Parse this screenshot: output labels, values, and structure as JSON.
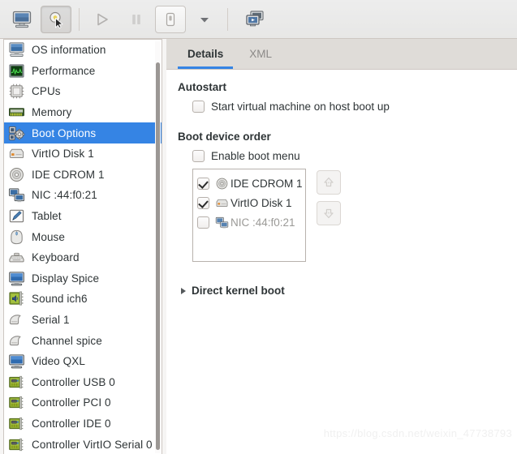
{
  "toolbar": {
    "buttons": [
      {
        "name": "console-view-button",
        "icon": "monitor-icon",
        "active": false
      },
      {
        "name": "details-view-button",
        "icon": "lightbulb-cursor-icon",
        "active": true
      },
      {
        "name": "run-button",
        "icon": "play-icon",
        "active": false
      },
      {
        "name": "pause-button",
        "icon": "pause-icon",
        "active": false
      },
      {
        "name": "shutdown-button",
        "icon": "power-icon",
        "active": false
      },
      {
        "name": "shutdown-menu-button",
        "icon": "chevron-down-icon",
        "active": false
      },
      {
        "name": "snapshots-button",
        "icon": "screens-icon",
        "active": false
      }
    ]
  },
  "sidebar": {
    "items": [
      {
        "label": "OS information",
        "icon": "computer-icon",
        "selected": false
      },
      {
        "label": "Performance",
        "icon": "performance-graph-icon",
        "selected": false
      },
      {
        "label": "CPUs",
        "icon": "cpu-chip-icon",
        "selected": false
      },
      {
        "label": "Memory",
        "icon": "memory-ram-icon",
        "selected": false
      },
      {
        "label": "Boot Options",
        "icon": "boot-options-icon",
        "selected": true
      },
      {
        "label": "VirtIO Disk 1",
        "icon": "harddisk-icon",
        "selected": false
      },
      {
        "label": "IDE CDROM 1",
        "icon": "cdrom-icon",
        "selected": false
      },
      {
        "label": "NIC :44:f0:21",
        "icon": "network-icon",
        "selected": false
      },
      {
        "label": "Tablet",
        "icon": "tablet-pen-icon",
        "selected": false
      },
      {
        "label": "Mouse",
        "icon": "mouse-icon",
        "selected": false
      },
      {
        "label": "Keyboard",
        "icon": "keyboard-icon",
        "selected": false
      },
      {
        "label": "Display Spice",
        "icon": "display-icon",
        "selected": false
      },
      {
        "label": "Sound ich6",
        "icon": "sound-card-icon",
        "selected": false
      },
      {
        "label": "Serial 1",
        "icon": "serial-port-icon",
        "selected": false
      },
      {
        "label": "Channel spice",
        "icon": "serial-port-icon",
        "selected": false
      },
      {
        "label": "Video QXL",
        "icon": "display-icon",
        "selected": false
      },
      {
        "label": "Controller USB 0",
        "icon": "controller-card-icon",
        "selected": false
      },
      {
        "label": "Controller PCI 0",
        "icon": "controller-card-icon",
        "selected": false
      },
      {
        "label": "Controller IDE 0",
        "icon": "controller-card-icon",
        "selected": false
      },
      {
        "label": "Controller VirtIO Serial 0",
        "icon": "controller-card-icon",
        "selected": false
      }
    ]
  },
  "tabs": [
    {
      "label": "Details",
      "active": true
    },
    {
      "label": "XML",
      "active": false
    }
  ],
  "details": {
    "autostart": {
      "title": "Autostart",
      "checkbox_label": "Start virtual machine on host boot up",
      "checked": false
    },
    "boot_device_order": {
      "title": "Boot device order",
      "enable_boot_menu_label": "Enable boot menu",
      "enable_boot_menu_checked": false,
      "devices": [
        {
          "label": "IDE CDROM 1",
          "checked": true,
          "enabled": true,
          "icon": "cdrom-icon"
        },
        {
          "label": "VirtIO Disk 1",
          "checked": true,
          "enabled": true,
          "icon": "harddisk-icon"
        },
        {
          "label": "NIC :44:f0:21",
          "checked": false,
          "enabled": false,
          "icon": "network-icon"
        }
      ],
      "move_up_label": "up-arrow",
      "move_down_label": "down-arrow"
    },
    "direct_kernel_boot": {
      "title": "Direct kernel boot",
      "expanded": false
    }
  },
  "watermark": "https://blog.csdn.net/weixin_47738793",
  "colors": {
    "selection_blue": "#3584e4",
    "tab_underline": "#3584e4",
    "chrome_bg": "#f6f5f4",
    "tabbar_bg": "#dfdcd8",
    "text": "#2e3436",
    "muted_text": "#9a9996"
  }
}
